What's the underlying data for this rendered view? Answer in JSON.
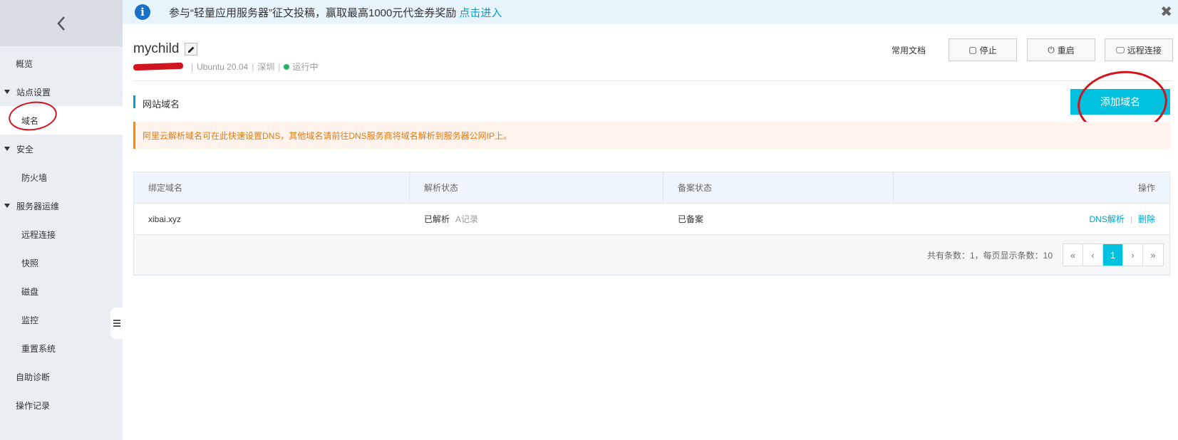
{
  "banner": {
    "text": "参与“轻量应用服务器”征文投稿，赢取最高1000元代金券奖励",
    "link": "点击进入",
    "close": "✖"
  },
  "sidebar": {
    "items": [
      {
        "label": "概览",
        "kind": "item"
      },
      {
        "label": "站点设置",
        "kind": "group"
      },
      {
        "label": "域名",
        "kind": "sub",
        "active": true
      },
      {
        "label": "安全",
        "kind": "group"
      },
      {
        "label": "防火墙",
        "kind": "sub"
      },
      {
        "label": "服务器运维",
        "kind": "group"
      },
      {
        "label": "远程连接",
        "kind": "sub"
      },
      {
        "label": "快照",
        "kind": "sub"
      },
      {
        "label": "磁盘",
        "kind": "sub"
      },
      {
        "label": "监控",
        "kind": "sub"
      },
      {
        "label": "重置系统",
        "kind": "sub"
      },
      {
        "label": "自助诊断",
        "kind": "item"
      },
      {
        "label": "操作记录",
        "kind": "item"
      }
    ]
  },
  "instance": {
    "name": "mychild",
    "os": "Ubuntu 20.04",
    "region": "深圳",
    "status": "运行中"
  },
  "header": {
    "docs": "常用文档",
    "stop": "停止",
    "restart": "重启",
    "remote": "远程连接"
  },
  "section": {
    "title": "网站域名",
    "add_button": "添加域名"
  },
  "notice": "阿里云解析域名可在此快速设置DNS，其他域名请前往DNS服务商将域名解析到服务器公网IP上。",
  "table": {
    "columns": [
      "绑定域名",
      "解析状态",
      "备案状态",
      "操作"
    ],
    "rows": [
      {
        "domain": "xibai.xyz",
        "dns_status": "已解析",
        "record": "A记录",
        "icp": "已备案",
        "action_dns": "DNS解析",
        "action_delete": "删除"
      }
    ]
  },
  "pagination": {
    "info": "共有条数：1，每页显示条数：10",
    "first": "«",
    "prev": "‹",
    "current": "1",
    "next": "›",
    "last": "»"
  },
  "colors": {
    "accent": "#00c1de",
    "link": "#00a2ca",
    "annotation": "#d1141f"
  }
}
